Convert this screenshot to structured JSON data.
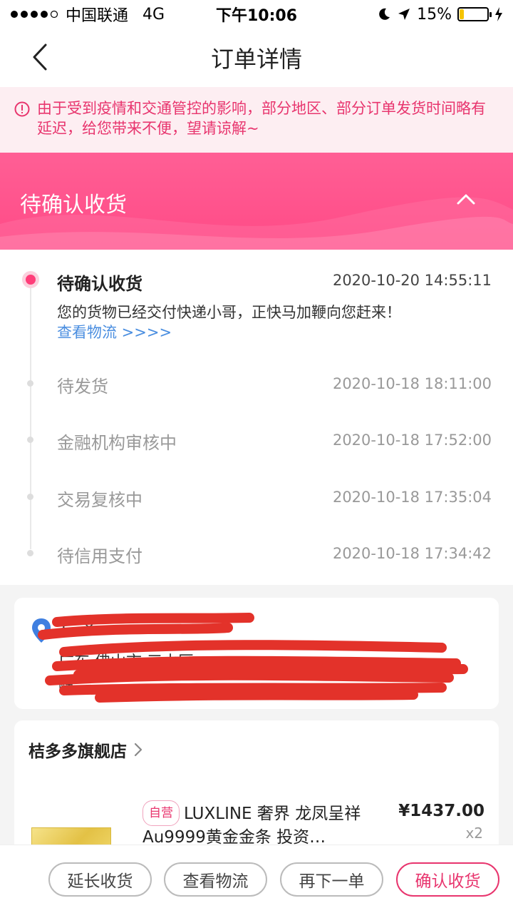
{
  "statusbar": {
    "carrier": "中国联通",
    "network": "4G",
    "time": "下午10:06",
    "battery": "15%",
    "battery_level": 0.15
  },
  "navbar": {
    "title": "订单详情",
    "back_icon": "chevron-left-icon"
  },
  "notice": {
    "text": "由于受到疫情和交通管控的影响，部分地区、部分订单发货时间略有延迟，给您带来不便，望请谅解~",
    "icon": "alert-circle-icon",
    "color": "#e8356e"
  },
  "status_banner": {
    "title": "待确认收货",
    "collapse_icon": "chevron-up-icon",
    "color": "#ff4a86"
  },
  "timeline": {
    "items": [
      {
        "title": "待确认收货",
        "time": "2020-10-20 14:55:11",
        "desc": "您的货物已经交付快递小哥，正快马加鞭向您赶来！",
        "link": "查看物流 >>>>"
      },
      {
        "title": "待发货",
        "time": "2020-10-18 18:11:00"
      },
      {
        "title": "金融机构审核中",
        "time": "2020-10-18 17:52:00"
      },
      {
        "title": "交易复核中",
        "time": "2020-10-18 17:35:04"
      },
      {
        "title": "待信用支付",
        "time": "2020-10-18 17:34:42"
      }
    ]
  },
  "address": {
    "line1": "1…8",
    "line2": "广东 佛山市,三水区",
    "line3": "峰 … ",
    "pin_icon": "location-pin-icon",
    "redacted": true
  },
  "shop": {
    "name": "桔多多旗舰店",
    "chevron_icon": "chevron-right-icon",
    "product": {
      "tag": "自营",
      "name": "LUXLINE 奢界 龙凤呈祥Au9999黄金金条 投资…",
      "price": "¥1437.00",
      "qty": "x2"
    }
  },
  "actions": {
    "extend": "延长收货",
    "logistics": "查看物流",
    "reorder": "再下一单",
    "confirm": "确认收货"
  }
}
